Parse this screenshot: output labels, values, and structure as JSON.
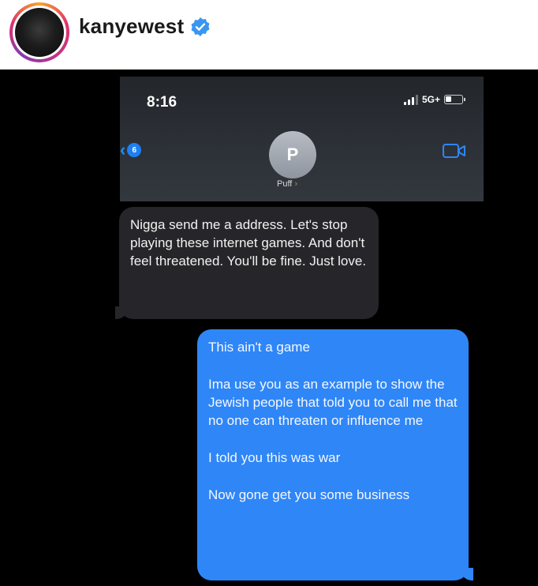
{
  "header": {
    "username": "kanyewest",
    "verified_icon": "verified-badge-icon",
    "brand_blue": "#3897f0"
  },
  "phone": {
    "status_bar": {
      "time": "8:16",
      "network": "5G+",
      "signal_icon": "signal-bars-icon",
      "battery_icon": "battery-icon"
    },
    "nav": {
      "back_icon": "chevron-left-icon",
      "unread_count": "6",
      "contact_initial": "P",
      "contact_name": "Puff",
      "facetime_icon": "video-camera-icon"
    }
  },
  "messages": {
    "incoming": "Nigga send me a address. Let's stop playing these internet games. And don't feel threatened. You'll be fine.  Just love.",
    "outgoing": [
      "This ain't a game",
      "Ima use you as an example to show the Jewish people that told you to call me that no one can threaten or influence me",
      "I told you this was war",
      "Now gone get you some business"
    ]
  },
  "colors": {
    "outgoing_bubble": "#2f86f7",
    "incoming_bubble": "#26262a",
    "background": "#000000"
  }
}
